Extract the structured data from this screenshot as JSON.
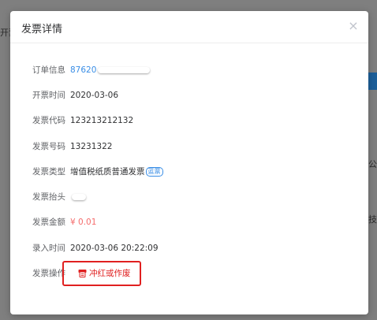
{
  "background": {
    "left_text": "开票",
    "right_text_1": "记公",
    "right_text_2": "技"
  },
  "modal": {
    "title": "发票详情",
    "close_icon": "×"
  },
  "fields": [
    {
      "label": "订单信息",
      "value": "87620"
    },
    {
      "label": "开票时间",
      "value": "2020-03-06"
    },
    {
      "label": "发票代码",
      "value": "123213212132"
    },
    {
      "label": "发票号码",
      "value": "13231322"
    },
    {
      "label": "发票类型",
      "value": "增值税纸质普通发票",
      "tag": "蓝票"
    },
    {
      "label": "发票抬头",
      "value": ""
    },
    {
      "label": "发票金额",
      "value": "¥ 0.01"
    },
    {
      "label": "录入时间",
      "value": "2020-03-06 20:22:09"
    },
    {
      "label": "发票操作",
      "value": ""
    }
  ],
  "action": {
    "label": "冲红或作废",
    "icon": "invoice-icon"
  },
  "colors": {
    "link": "#3a8ee6",
    "danger": "#e02020",
    "price": "#f56c6c"
  }
}
